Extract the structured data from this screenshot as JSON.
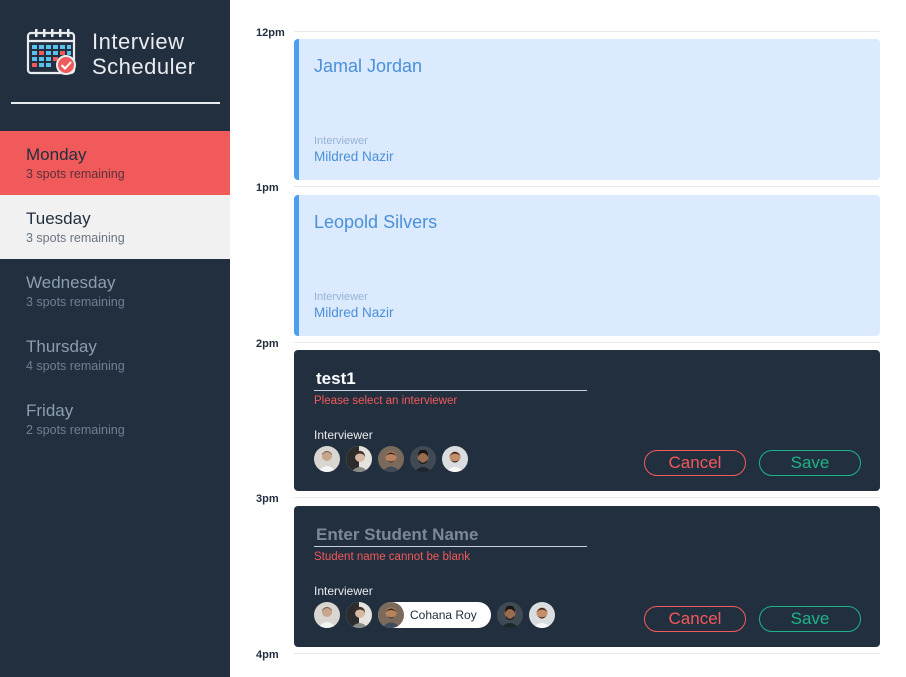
{
  "app": {
    "brand_line1": "Interview",
    "brand_line2": "Scheduler",
    "logo_icon": "calendar-check-icon",
    "colors": {
      "sidebar": "#222f3e",
      "selected": "#f15a5a",
      "accent_blue": "#4a90d9",
      "cancel": "#f15a5a",
      "save": "#1fb38a"
    }
  },
  "days": [
    {
      "name": "Monday",
      "spots": "3 spots remaining",
      "state": "selected"
    },
    {
      "name": "Tuesday",
      "spots": "3 spots remaining",
      "state": "hover"
    },
    {
      "name": "Wednesday",
      "spots": "3 spots remaining",
      "state": "normal"
    },
    {
      "name": "Thursday",
      "spots": "4 spots remaining",
      "state": "normal"
    },
    {
      "name": "Friday",
      "spots": "2 spots remaining",
      "state": "normal"
    }
  ],
  "times": [
    "12pm",
    "1pm",
    "2pm",
    "3pm",
    "4pm"
  ],
  "appointments": [
    {
      "student": "Jamal Jordan",
      "interviewer_label": "Interviewer",
      "interviewer": "Mildred Nazir"
    },
    {
      "student": "Leopold Silvers",
      "interviewer_label": "Interviewer",
      "interviewer": "Mildred Nazir"
    }
  ],
  "forms": [
    {
      "student_value": "test1",
      "placeholder": "Enter Student Name",
      "error": "Please select an interviewer",
      "interviewer_label": "Interviewer",
      "selected_interviewer": "",
      "cancel_label": "Cancel",
      "save_label": "Save"
    },
    {
      "student_value": "",
      "placeholder": "Enter Student Name",
      "error": "Student name cannot be blank",
      "interviewer_label": "Interviewer",
      "selected_interviewer": "Cohana Roy",
      "cancel_label": "Cancel",
      "save_label": "Save"
    }
  ]
}
